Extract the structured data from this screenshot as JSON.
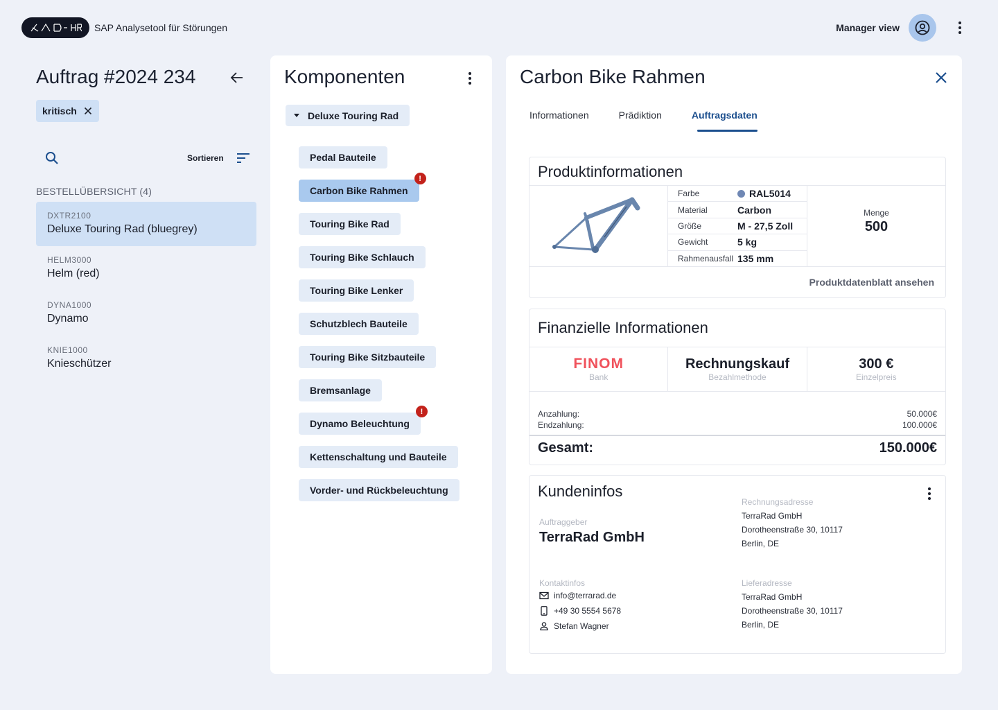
{
  "header": {
    "app_title": "SAP Analysetool für Störungen",
    "manager_view": "Manager view",
    "icons": [
      "logo",
      "account-circle-icon",
      "more-vert-icon"
    ]
  },
  "order": {
    "title": "Auftrag #2024 234",
    "tag": "kritisch",
    "sort_label": "Sortieren",
    "overview_heading": "BESTELLÜBERSICHT (4)",
    "items": [
      {
        "code": "DXTR2100",
        "name": "Deluxe Touring Rad (bluegrey)",
        "selected": true
      },
      {
        "code": "HELM3000",
        "name": "Helm (red)",
        "selected": false
      },
      {
        "code": "DYNA1000",
        "name": "Dynamo",
        "selected": false
      },
      {
        "code": "KNIE1000",
        "name": "Knieschützer",
        "selected": false
      }
    ]
  },
  "components": {
    "title": "Komponenten",
    "root": "Deluxe Touring Rad",
    "items": [
      {
        "label": "Pedal Bauteile",
        "selected": false,
        "alert": false
      },
      {
        "label": "Carbon Bike Rahmen",
        "selected": true,
        "alert": true
      },
      {
        "label": "Touring Bike Rad",
        "selected": false,
        "alert": false
      },
      {
        "label": "Touring Bike Schlauch",
        "selected": false,
        "alert": false
      },
      {
        "label": "Touring Bike Lenker",
        "selected": false,
        "alert": false
      },
      {
        "label": "Schutzblech Bauteile",
        "selected": false,
        "alert": false
      },
      {
        "label": "Touring Bike Sitzbauteile",
        "selected": false,
        "alert": false
      },
      {
        "label": "Bremsanlage",
        "selected": false,
        "alert": false
      },
      {
        "label": "Dynamo Beleuchtung",
        "selected": false,
        "alert": true
      },
      {
        "label": "Kettenschaltung und Bauteile",
        "selected": false,
        "alert": false
      },
      {
        "label": "Vorder- und Rückbeleuchtung",
        "selected": false,
        "alert": false
      }
    ],
    "alert_symbol": "!"
  },
  "detail": {
    "title": "Carbon Bike Rahmen",
    "tabs": [
      "Informationen",
      "Prädiktion",
      "Auftragsdaten"
    ],
    "active_tab": "Auftragsdaten",
    "product": {
      "title": "Produktinformationen",
      "attributes": [
        {
          "label": "Farbe",
          "value": "RAL5014",
          "swatch": "#6f87b4"
        },
        {
          "label": "Material",
          "value": "Carbon"
        },
        {
          "label": "Größe",
          "value": "M - 27,5 Zoll"
        },
        {
          "label": "Gewicht",
          "value": "5 kg"
        },
        {
          "label": "Rahmenausfall",
          "value": "135 mm"
        }
      ],
      "quantity_label": "Menge",
      "quantity_value": "500",
      "datasheet_link": "Produktdatenblatt ansehen"
    },
    "finance": {
      "title": "Finanzielle Informationen",
      "bank_logo": "FINOM",
      "bank_label": "Bank",
      "payment_method": "Rechnungskauf",
      "payment_label": "Bezahlmethode",
      "unit_price": "300 €",
      "unit_price_label": "Einzelpreis",
      "down_payment_label": "Anzahlung:",
      "down_payment_value": "50.000€",
      "final_payment_label": "Endzahlung:",
      "final_payment_value": "100.000€",
      "total_label": "Gesamt:",
      "total_value": "150.000€"
    },
    "customer": {
      "title": "Kundeninfos",
      "client_label": "Auftraggeber",
      "client_name": "TerraRad GmbH",
      "billing_label": "Rechnungsadresse",
      "billing_lines": [
        "TerraRad GmbH",
        "Dorotheenstraße 30, 10117",
        "Berlin, DE"
      ],
      "contact_label": "Kontaktinfos",
      "email": "info@terrarad.de",
      "phone": "+49 30 5554 5678",
      "person": "Stefan Wagner",
      "shipping_label": "Lieferadresse",
      "shipping_lines": [
        "TerraRad GmbH",
        "Dorotheenstraße 30, 10117",
        "Berlin, DE"
      ]
    }
  },
  "colors": {
    "background": "#eef1f8",
    "selected": "#cfe0f5",
    "chip": "#e4ecf7",
    "chip_selected": "#a9c9ee",
    "accent": "#1c4f8e",
    "alert": "#c3221b",
    "finom": "#f0525c"
  }
}
